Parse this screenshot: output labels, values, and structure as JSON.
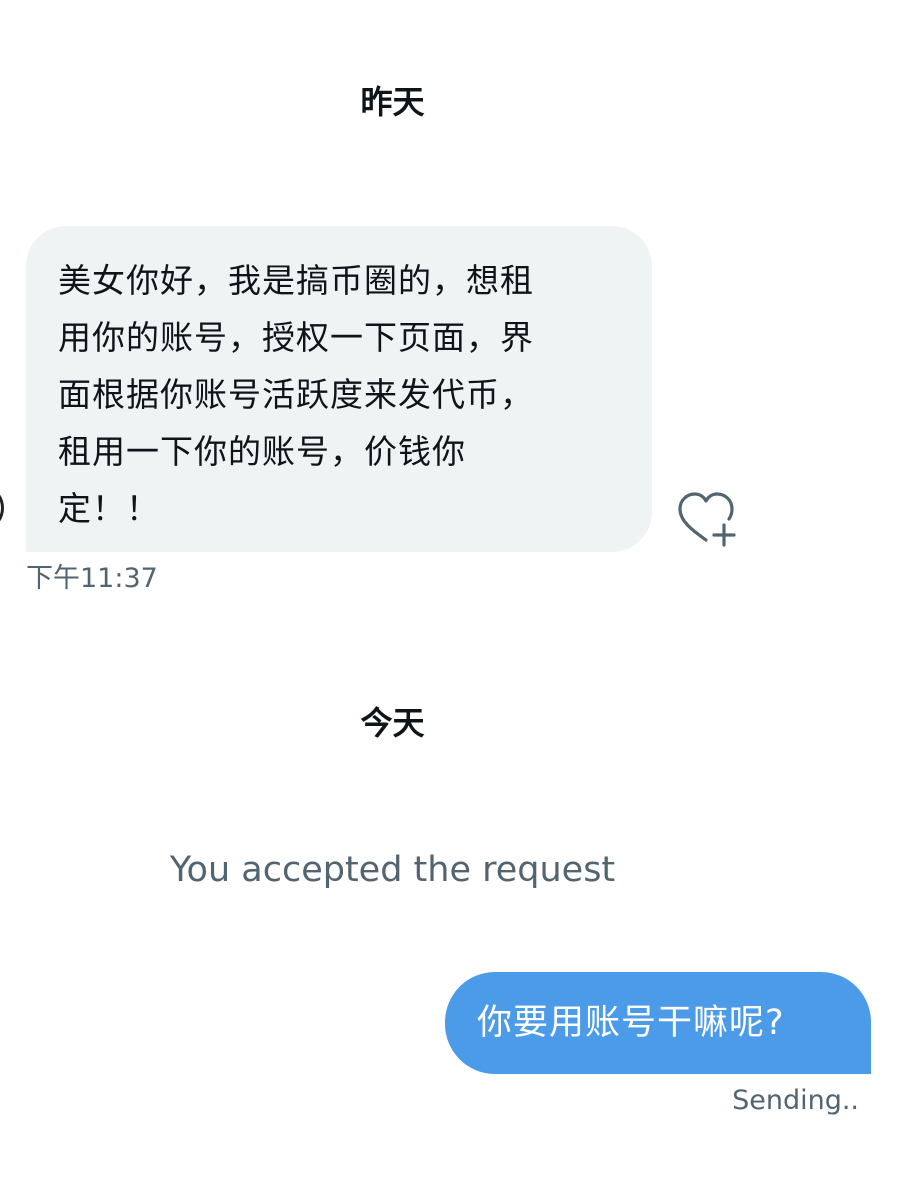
{
  "conversation": {
    "day_separators": {
      "yesterday": "昨天",
      "today": "今天"
    },
    "incoming_message": {
      "text": "美女你好，我是搞币圈的，想租\n用你的账号，授权一下页面，界\n面根据你账号活跃度来发代币，\n租用一下你的账号，价钱你\n定！！",
      "timestamp": "下午11:37",
      "reaction_icon": "heart-plus-icon"
    },
    "system_message": "You accepted the request",
    "outgoing_message": {
      "text": "你要用账号干嘛呢?",
      "status": "Sending.."
    }
  },
  "colors": {
    "incoming_bubble": "#eff3f4",
    "outgoing_bubble": "#4c9be8",
    "secondary_text": "#536471",
    "primary_text": "#0f1419"
  }
}
